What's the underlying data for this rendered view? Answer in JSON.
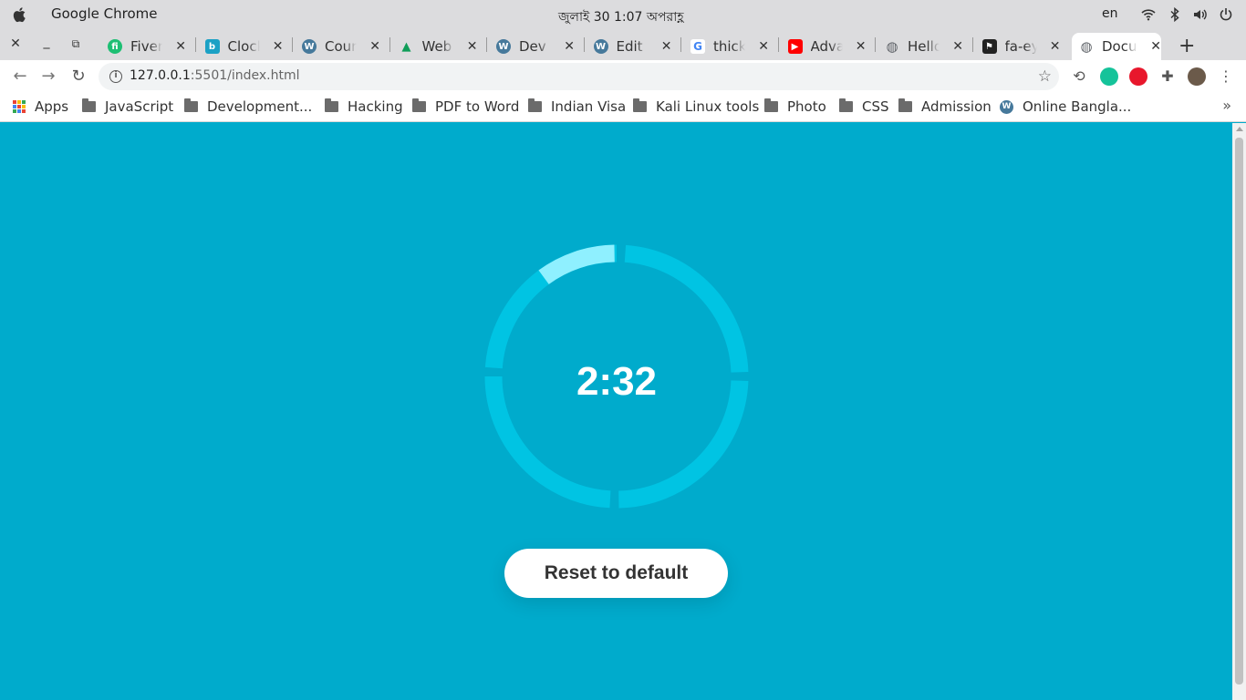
{
  "os": {
    "app_name": "Google Chrome",
    "clock": "জুলাই 30   1:07 অপরাহ্ণ",
    "language": "en"
  },
  "tabs": [
    {
      "title": "Fiverr",
      "favicon": "fiverr-icon",
      "favicon_color": "#1dbf73",
      "favicon_glyph": "fi"
    },
    {
      "title": "Clock",
      "favicon": "clock-site-icon",
      "favicon_color": "#1ba1c5",
      "favicon_glyph": "b"
    },
    {
      "title": "Count",
      "favicon": "wordpress-icon",
      "favicon_color": "#46799b",
      "favicon_glyph": "W"
    },
    {
      "title": "Web D",
      "favicon": "google-drive-icon",
      "favicon_color": "#f4b400",
      "favicon_glyph": "▲"
    },
    {
      "title": "Dev Si",
      "favicon": "wordpress-icon",
      "favicon_color": "#46799b",
      "favicon_glyph": "W"
    },
    {
      "title": "Edit Pa",
      "favicon": "wordpress-icon",
      "favicon_color": "#46799b",
      "favicon_glyph": "W"
    },
    {
      "title": "thick r",
      "favicon": "google-icon",
      "favicon_color": "#ffffff",
      "favicon_glyph": "G"
    },
    {
      "title": "Advan",
      "favicon": "youtube-icon",
      "favicon_color": "#ff0000",
      "favicon_glyph": "▶"
    },
    {
      "title": "Hello,",
      "favicon": "globe-icon",
      "favicon_color": "#5f6368",
      "favicon_glyph": "◍"
    },
    {
      "title": "fa-eye",
      "favicon": "font-awesome-icon",
      "favicon_color": "#222222",
      "favicon_glyph": "⚑"
    },
    {
      "title": "Docur",
      "favicon": "globe-icon",
      "favicon_color": "#5f6368",
      "favicon_glyph": "◍",
      "active": true
    }
  ],
  "address_bar": {
    "url_host": "127.0.0.1",
    "url_rest": ":5501/index.html"
  },
  "bookmarks": [
    {
      "label": "Apps",
      "icon": "apps-grid-icon"
    },
    {
      "label": "JavaScript",
      "icon": "folder-icon"
    },
    {
      "label": "Development...",
      "icon": "folder-icon"
    },
    {
      "label": "Hacking",
      "icon": "folder-icon"
    },
    {
      "label": "PDF to Word",
      "icon": "folder-icon"
    },
    {
      "label": "Indian Visa",
      "icon": "folder-icon"
    },
    {
      "label": "Kali Linux tools",
      "icon": "folder-icon"
    },
    {
      "label": "Photo",
      "icon": "folder-icon"
    },
    {
      "label": "CSS",
      "icon": "folder-icon"
    },
    {
      "label": "Admission",
      "icon": "folder-icon"
    },
    {
      "label": "Online Bangla...",
      "icon": "wordpress-icon"
    }
  ],
  "page": {
    "timer_text": "2:32",
    "reset_label": "Reset to default",
    "background_color": "#00abcc",
    "ring_color": "#00c4e3",
    "progress_color": "#8ff0ff",
    "segments": 4,
    "progress_fraction": 0.09
  }
}
